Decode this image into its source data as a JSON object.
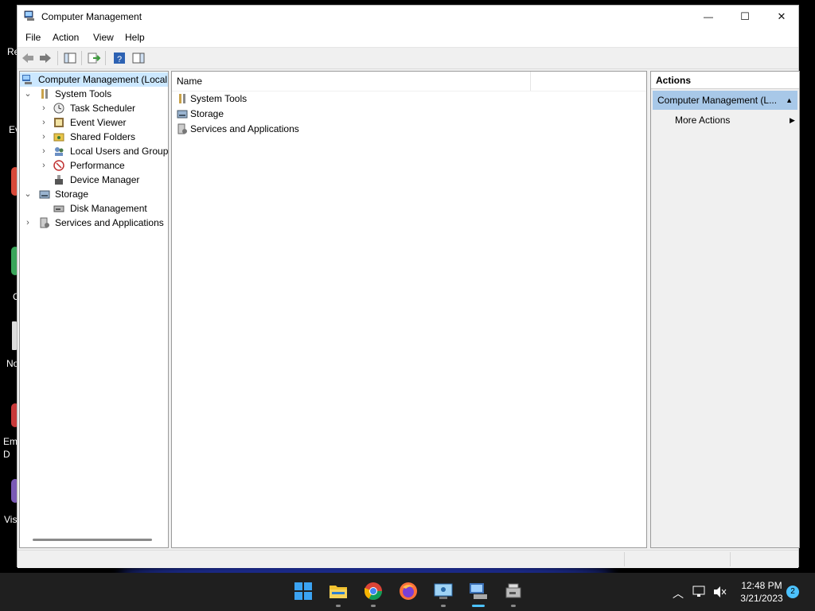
{
  "desktop": {
    "items": [
      "Re",
      "Ev",
      "C",
      "No",
      "Em D",
      "Vis"
    ]
  },
  "window": {
    "title": "Computer Management",
    "controls": {
      "minimize": "—",
      "maximize": "☐",
      "close": "✕"
    }
  },
  "menu": [
    "File",
    "Action",
    "View",
    "Help"
  ],
  "tree": {
    "root": "Computer Management (Local",
    "system_tools": "System Tools",
    "task_scheduler": "Task Scheduler",
    "event_viewer": "Event Viewer",
    "shared_folders": "Shared Folders",
    "local_users": "Local Users and Groups",
    "performance": "Performance",
    "device_manager": "Device Manager",
    "storage": "Storage",
    "disk_management": "Disk Management",
    "services": "Services and Applications"
  },
  "list": {
    "column_name": "Name",
    "rows": [
      "System Tools",
      "Storage",
      "Services and Applications"
    ]
  },
  "actions": {
    "title": "Actions",
    "section": "Computer Management (L...",
    "more": "More Actions"
  },
  "taskbar": {
    "time": "12:48 PM",
    "date": "3/21/2023",
    "notifications": "2"
  },
  "colors": {
    "selection": "#cce8ff",
    "action_header": "#a8c8e8",
    "taskbar": "#1f1f1f"
  }
}
